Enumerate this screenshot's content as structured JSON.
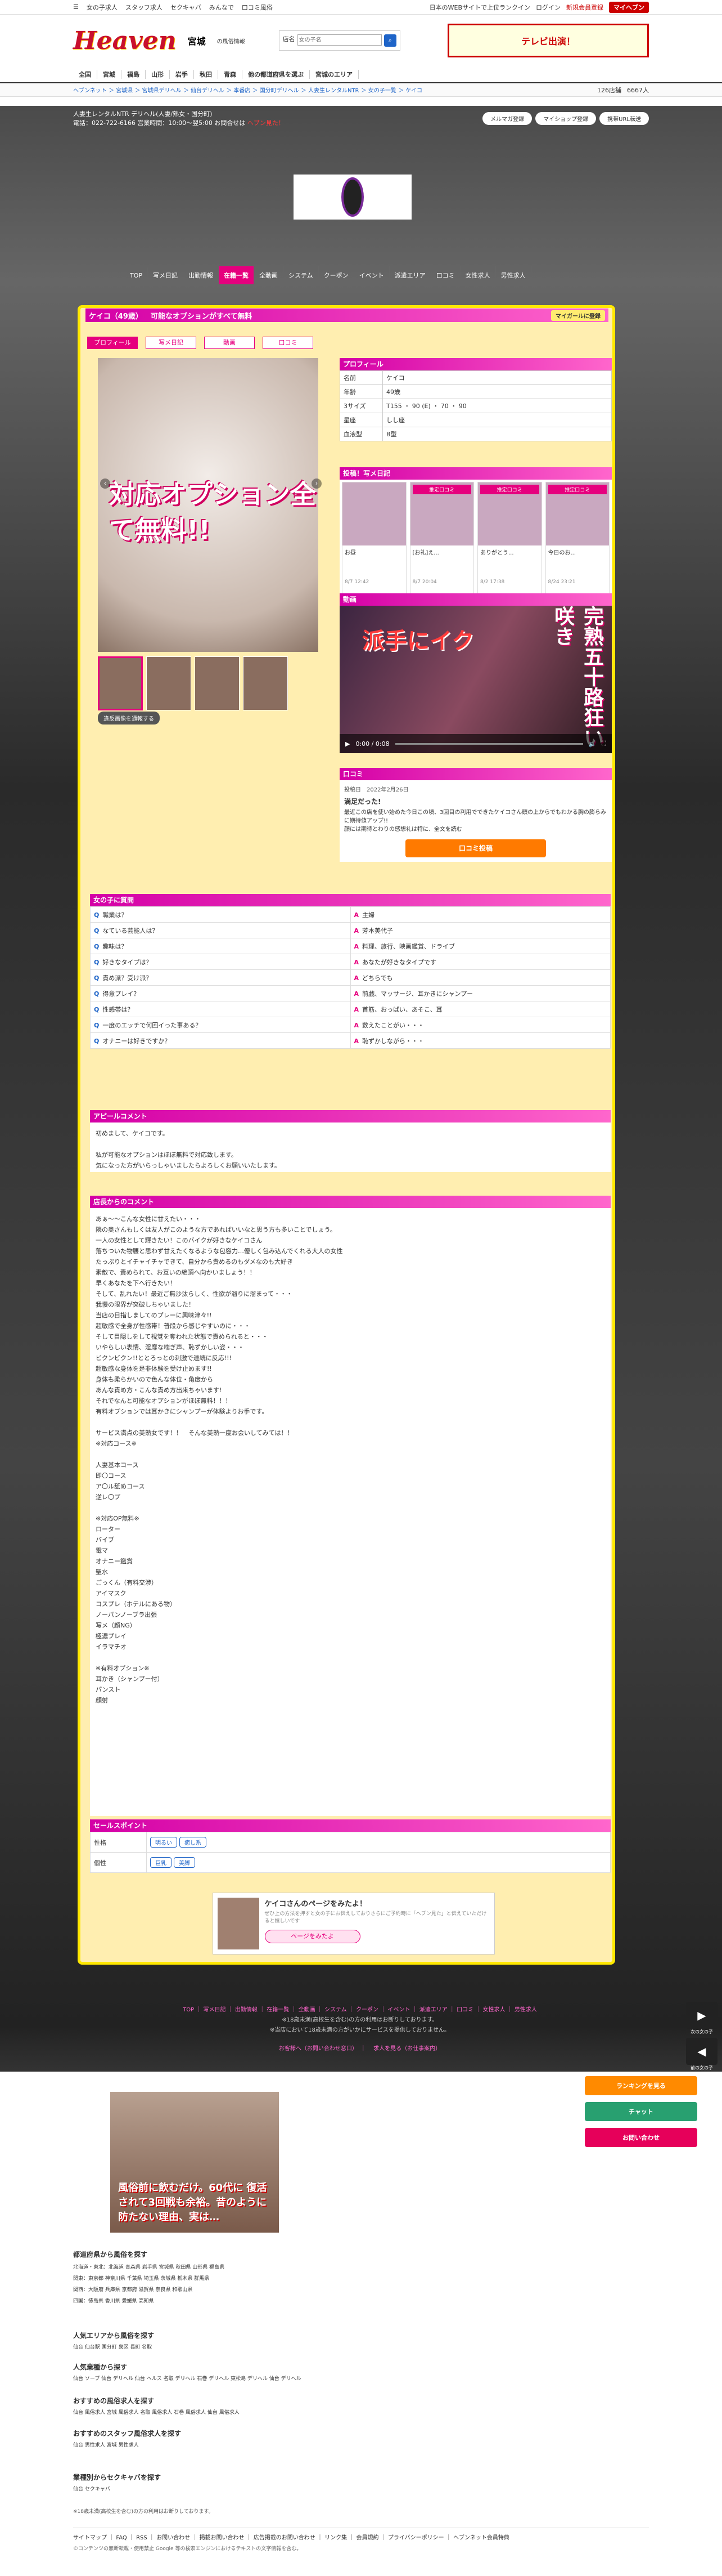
{
  "topbar": {
    "links": [
      "女の子求人",
      "スタッフ求人",
      "セクキャバ",
      "みんなで",
      "口コミ風俗"
    ],
    "right": [
      "日本のWEBサイトで上位ランクイン",
      "ログイン",
      "新規会員登録"
    ],
    "mypage": "マイヘブン"
  },
  "header": {
    "logo": "Heaven",
    "pref": "宮城",
    "pref_sub": "の風俗情報",
    "search_label": "店名",
    "search_placeholder": "女の子名",
    "ad": "テレビ出演！"
  },
  "nav": [
    "全国",
    "宮城",
    "福島",
    "山形",
    "岩手",
    "秋田",
    "青森",
    "他の都道府県を選ぶ",
    "宮城のエリア"
  ],
  "crumbs": "ヘブンネット ＞ 宮城県 ＞ 宮城県デリヘル ＞ 仙台デリヘル ＞ 本番店 ＞ 国分町デリヘル ＞ 人妻生レンタルNTR ＞ 女の子一覧 ＞ ケイコ",
  "stats": {
    "shops": "126店舗",
    "girls": "6667人"
  },
  "shop": {
    "name": "人妻生レンタルNTR デリヘル(人妻/熟女・国分町)",
    "tel": "電話：022-722-6166 営業時間：10:00〜翌5:00 お問合せは",
    "tel_note": "ヘブン見た！",
    "buttons": [
      "メルマガ登録",
      "マイショップ登録",
      "携帯URL転送"
    ]
  },
  "shopnav": [
    "TOP",
    "写メ日記",
    "出勤情報",
    "在籍一覧",
    "全動画",
    "システム",
    "クーポン",
    "イベント",
    "派遣エリア",
    "口コミ",
    "女性求人",
    "男性求人"
  ],
  "girl": {
    "title": "ケイコ（49歳）",
    "catch": "可能なオプションがすべて無料",
    "fav": "マイガールに登録",
    "tabs": [
      "プロフィール",
      "写メ日記",
      "動画",
      "口コミ"
    ],
    "caption": "対応オプション全て無料!!",
    "report": "違反画像を通報する"
  },
  "profile": {
    "heading": "プロフィール",
    "rows": [
      [
        "名前",
        "ケイコ"
      ],
      [
        "年齢",
        "49歳"
      ],
      [
        "3サイズ",
        "T155 ・ 90 (E) ・ 70 ・ 90"
      ],
      [
        "星座",
        "しし座"
      ],
      [
        "血液型",
        "B型"
      ]
    ]
  },
  "diary": {
    "heading": "投稿！写メ日記",
    "cards": [
      {
        "tag": "",
        "title": "お昼",
        "date": "8/7 12:42"
      },
      {
        "tag": "推定口コミ",
        "title": "[お礼]え...",
        "date": "8/7 20:04"
      },
      {
        "tag": "推定口コミ",
        "title": "ありがとう...",
        "date": "8/2 17:38"
      },
      {
        "tag": "推定口コミ",
        "title": "今日のお...",
        "date": "8/24 23:21"
      }
    ]
  },
  "video": {
    "heading": "動画",
    "text1": "派手にイク",
    "text2": "完熟五十路狂い咲き",
    "time": "0:00 / 0:08"
  },
  "review": {
    "heading": "口コミ",
    "date": "投稿日　2022年2月26日",
    "title": "満足だった!",
    "body": "最近この店を使い始めた今日この頃、3回目の利用でできたケイコさん頭の上からでもわかる胸の膨らみに期待値アップ!!\n顔には期待とわりの感想礼は特に、全文を読む",
    "button": "口コミ投稿"
  },
  "qa": {
    "heading": "女の子に質問",
    "rows": [
      [
        "職業は？",
        "主婦"
      ],
      [
        "なている芸能人は？",
        "芳本美代子"
      ],
      [
        "趣味は？",
        "料理、旅行、映画鑑賞、ドライブ"
      ],
      [
        "好きなタイプは？",
        "あなたが好きなタイプです"
      ],
      [
        "責め派？受け派？",
        "どちらでも"
      ],
      [
        "得意プレイ？",
        "前戯、マッサージ、耳かきにシャンプー"
      ],
      [
        "性感帯は？",
        "首筋、おっぱい、あそこ、耳"
      ],
      [
        "一度のエッチで何回イった事ある？",
        "数えたことがい・・・"
      ],
      [
        "オナニーは好きですか？",
        "恥ずかしながら・・・"
      ]
    ]
  },
  "appeal": {
    "heading": "アピールコメント",
    "text": "初めまして、ケイコです。\n\n私が可能なオプションはほぼ無料で対応致します。\n気になった方がいらっしゃいましたらよろしくお願いいたします。"
  },
  "staff": {
    "heading": "店長からのコメント",
    "text": "あぁ〜〜こんな女性に甘えたい・・・\n隣の奥さんもしくは友人がこのような方であればいいなと思う方も多いことでしょう。\n一人の女性として輝きたい！このバイクが好きなケイコさん\n落ちついた物腰と思わず甘えたくなるような包容力…優しく包み込んでくれる大人の女性\nたっぷりとイチャイチャできて、自分から責めるのもダメなのも大好き\n素敵で、責められて、お互いの絶頂へ向かいましょう！！\n早くあなたを下へ行きたい！\nそして、乱れたい！最近ご無沙汰らしく、性欲が溜りに溜まって・・・\n我慢の限界が突破しちゃいました！\n当店の目指しましてのプレーに興味津々!!\n超敏感で全身が性感帯！普段から感じやすいのに・・・\nそして目隠しをして視覚を奪われた状態で責められると・・・\nいやらしい表情、淫靡な喘ぎ声、恥ずかしい姿・・・\nビクンビクン!!ととろっとの刺激で連続に反応!!!\n超敏感な身体を是非体験を受け止めます!!\n身体も柔らかいので色んな体位・角度から\nあんな責め方・こんな責め方出来ちゃいます!\nそれでなんと可能なオプションがほぼ無料！！！\n有料オプションでは耳かきにシャンプーが体験よりお手です。\n\nサービス満点の美熟女です！！　そんな美熟一度お会いしてみては！！\n※対応コース※\n\n人妻基本コース\n即〇コース\nア〇ル舐めコース\n逆レ〇プ\n\n※対応OP無料※\nローター\nバイブ\n電マ\nオナニー鑑賞\n聖水\nごっくん（有料交渉）\nアイマスク\nコスプレ（ホテルにある物）\nノーパンノーブラ出張\n写メ（顔NG）\n極濃プレイ\nイラマチオ\n\n※有料オプション※\n耳かき（シャンプー付）\nパンスト\n顔射"
  },
  "points": {
    "heading": "セールスポイント",
    "rows": [
      {
        "k": "性格",
        "v": [
          "明るい",
          "癒し系"
        ]
      },
      {
        "k": "個性",
        "v": [
          "巨乳",
          "美脚"
        ]
      }
    ]
  },
  "banner": {
    "title": "ケイコさんのページをみたよ！",
    "sub": "ぜひ上の方法を押すと女の子にお伝えしておりさらにご予約時に「ヘブン見た」と伝えていただけると嬉しいです",
    "button": "ページをみたよ"
  },
  "footlinks": [
    "TOP",
    "写メ日記",
    "出勤情報",
    "在籍一覧",
    "全動画",
    "システム",
    "クーポン",
    "イベント",
    "派遣エリア",
    "口コミ",
    "女性求人",
    "男性求人"
  ],
  "footnote1": "※18歳未満(高校生を含む)の方の利用はお断りしております。",
  "footnote2": "※当店において18歳未満の方がいかにサービスを提供しておりません。",
  "foot_job": [
    "お客様へ（お問い合わせ窓口）",
    "求人を見る（お仕事案内）"
  ],
  "fixed": [
    "ランキングを見る",
    "チャット",
    "お問い合わせ"
  ],
  "feature_caption": "風俗前に飲むだけ。60代に 復活されて3回戦も余裕。昔のように防たない理由、実は…",
  "footer_sections": [
    {
      "h": "都道府県から風俗を探す",
      "rows": [
        "北海道・東北：北海道 青森県 岩手県 宮城県 秋田県 山形県 福島県",
        "関東：東京都 神奈川県 千葉県 埼玉県 茨城県 栃木県 群馬県",
        "関西：大阪府 兵庫県 京都府 滋賀県 奈良県 和歌山県",
        "四国：徳島県 香川県 愛媛県 高知県"
      ]
    },
    {
      "h": "人気エリアから風俗を探す",
      "rows": [
        "仙台 仙台駅 国分町 泉区 長町 名取"
      ]
    },
    {
      "h": "人気業種から探す",
      "rows": [
        "仙台 ソープ 仙台 デリヘル 仙台 ヘルス 名取 デリヘル 石巻 デリヘル 東松島 デリヘル 仙台 デリヘル"
      ]
    },
    {
      "h": "おすすめの風俗求人を探す",
      "rows": [
        "仙台 風俗求人 宮城 風俗求人 名取 風俗求人 石巻 風俗求人 仙台 風俗求人"
      ]
    },
    {
      "h": "おすすめのスタッフ風俗求人を探す",
      "rows": [
        "仙台 男性求人 宮城 男性求人"
      ]
    },
    {
      "h": "業種別からセクキャバを探す",
      "rows": [
        "仙台 セクキャバ"
      ]
    }
  ],
  "footer_bottom": "サイトマップ ｜ FAQ ｜ RSS ｜ お問い合わせ ｜ 掲載お問い合わせ ｜ 広告掲載のお問い合わせ ｜ リンク集 ｜ 会員規約 ｜ プライバシーポリシー ｜ ヘブンネット会員特典",
  "copyright": "©コンテンツの無断転載・使用禁止 Google 等の検索エンジンにおけるテキストの文字情報を含む。",
  "colors": {
    "accent": "#e6007e",
    "frame": "#ffe800",
    "brand": "#c8102e"
  }
}
